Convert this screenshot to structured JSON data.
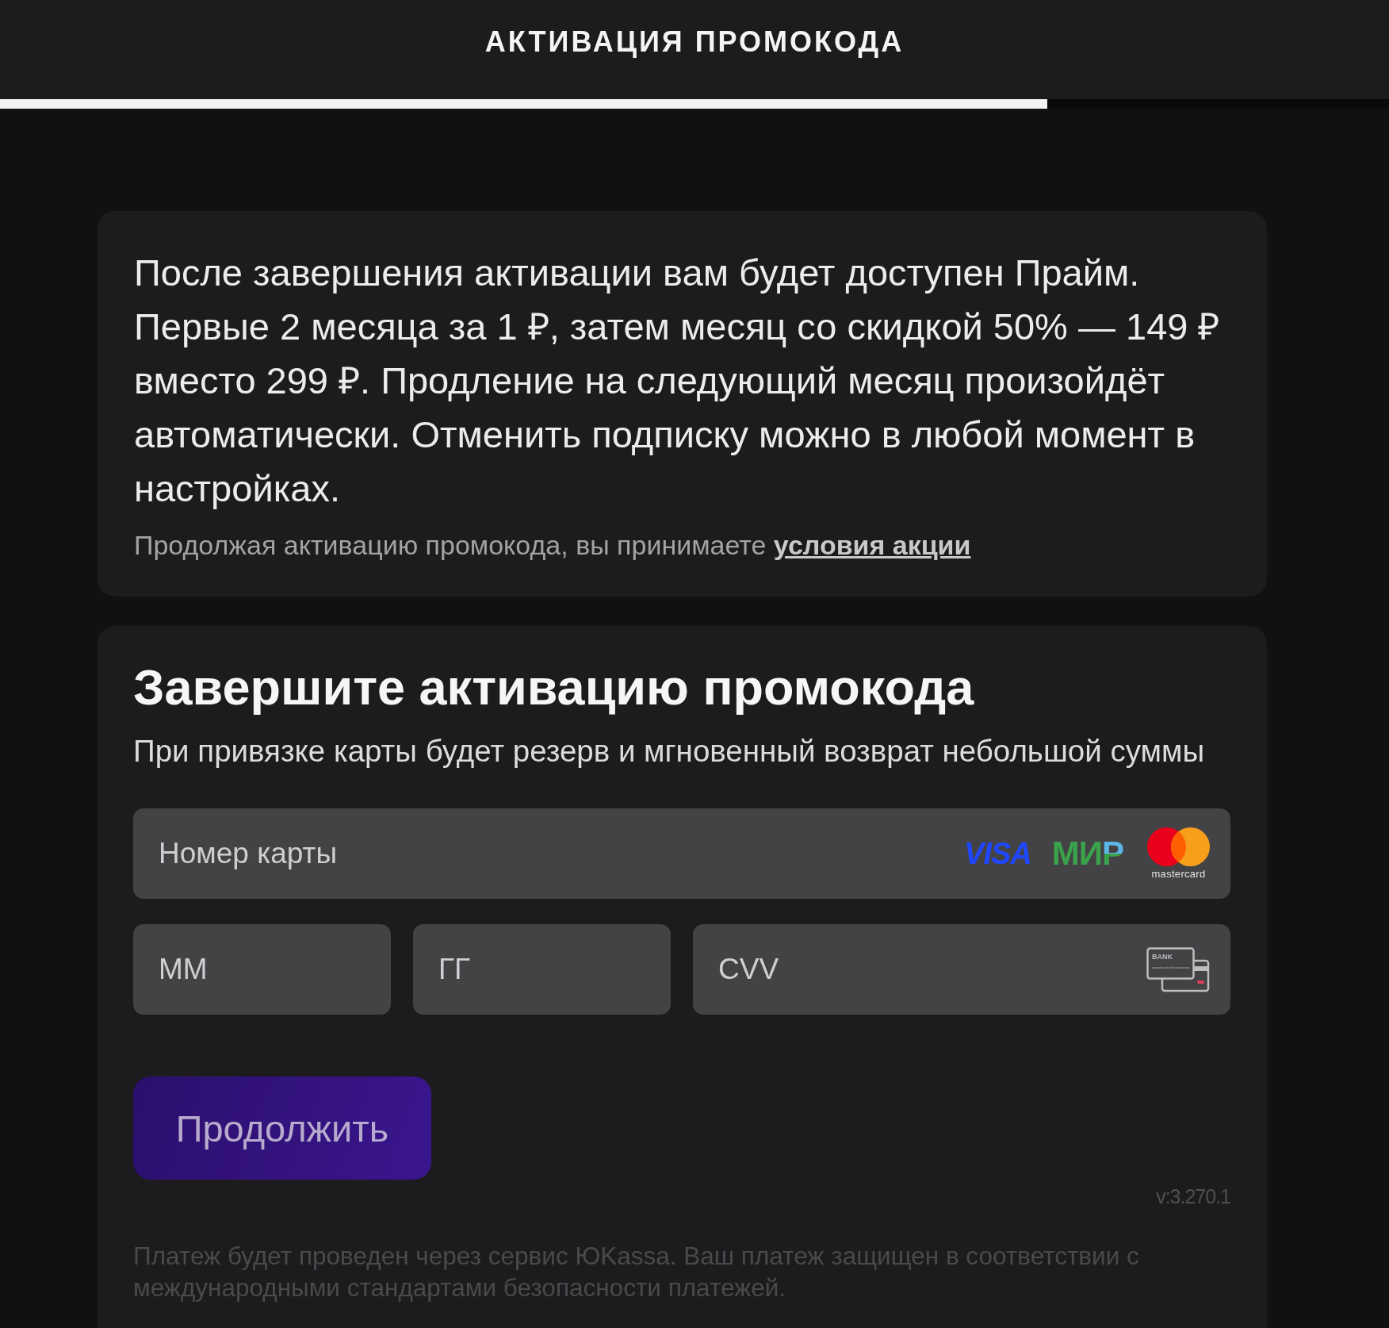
{
  "header": {
    "title": "АКТИВАЦИЯ ПРОМОКОДА"
  },
  "progress": {
    "level": 0.754
  },
  "info_card": {
    "text": "После завершения активации вам будет доступен Прайм. Первые 2 месяца за 1 ₽, затем месяц со скидкой 50% — 149 ₽ вместо 299 ₽. Продление на следующий месяц произойдёт автоматически. Отменить подписку можно в любой момент в настройках.",
    "consent": {
      "text": "Продолжая активацию промокода, вы принимаете",
      "link": "условия акции"
    }
  },
  "form": {
    "title": "Завершите активацию промокода",
    "subtitle": "При привязке карты будет резерв и мгновенный возврат небольшой суммы",
    "fields": [
      {
        "kind": "card_number",
        "placeholder": "Номер карты",
        "logos": [
          {
            "kind": "visa",
            "text": "VISA"
          },
          {
            "kind": "mir",
            "text": "МИР"
          },
          {
            "kind": "mastercard",
            "text": "mastercard"
          }
        ]
      },
      {
        "kind": "month",
        "placeholder": "ММ"
      },
      {
        "kind": "year",
        "placeholder": "ГГ"
      },
      {
        "kind": "cvv",
        "placeholder": "CVV",
        "card_icon_text": "BANK"
      }
    ],
    "button": {
      "label": "Продолжить",
      "disabled": true
    },
    "version": "v:3.270.1",
    "footer_note": "Платеж будет проведен через сервис ЮKassa. Ваш платеж защищен в соответствии с международными стандартами безопасности платежей."
  }
}
